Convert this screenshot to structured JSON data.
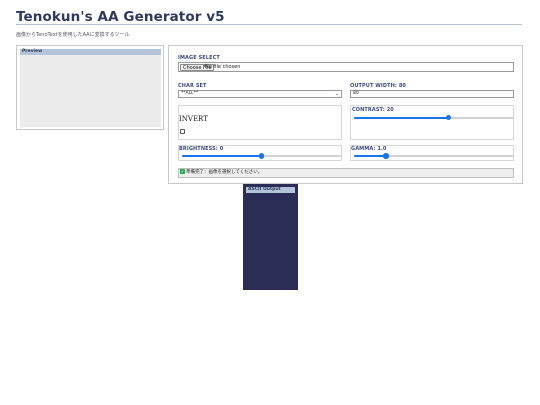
{
  "header": {
    "title": "Tenokun's AA Generator v5",
    "subtitle": "画像からTenoTextを使用したAAに変換するツール"
  },
  "preview": {
    "title": "Preview"
  },
  "image_select": {
    "label": "IMAGE SELECT",
    "button_label": "Choose File",
    "file_status": "No file chosen"
  },
  "char_set": {
    "label": "CHAR SET",
    "selected": "**ALL**"
  },
  "output_width": {
    "label": "OUTPUT WIDTH: 80",
    "value": "80"
  },
  "invert": {
    "label": "INVERT",
    "checked": false
  },
  "contrast": {
    "label": "CONTRAST: 20",
    "level_fraction": 0.59
  },
  "brightness": {
    "label": "BRIGHTNESS: 0",
    "level_fraction": 0.5
  },
  "gamma": {
    "label": "GAMMA: 1.0",
    "level_fraction": 0.2
  },
  "status": {
    "text": "準備完了：画像を選択してください。",
    "icon": "check-icon",
    "icon_color": "#2fa84f"
  },
  "ascii_output": {
    "title": "ASCII Output"
  },
  "colors": {
    "accent": "#1a73e8",
    "title": "#2d3a5c",
    "label": "#3b4b82",
    "output_bg": "#2b2d57",
    "panel_head": "#b3c4d8"
  }
}
